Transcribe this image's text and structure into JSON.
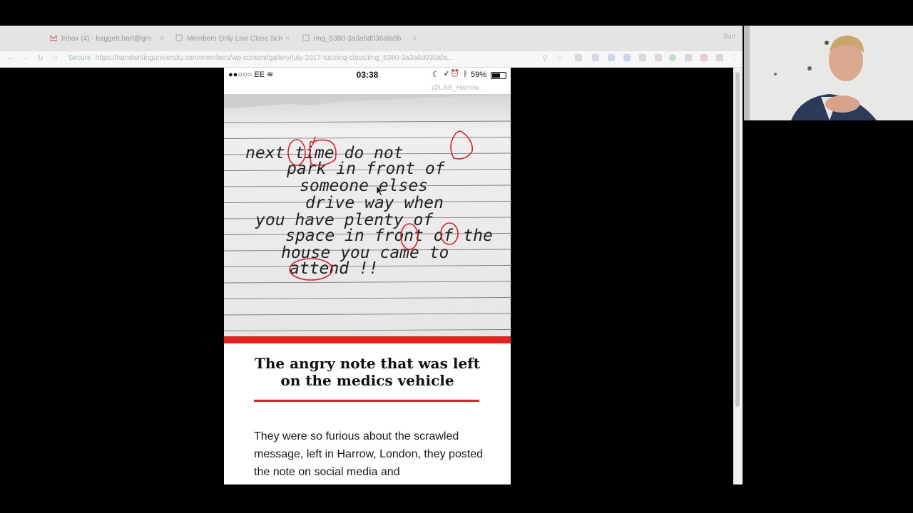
{
  "browser": {
    "tabs": [
      {
        "label": "Inbox (4) - baggett.bart@gm",
        "icon": "gmail-icon"
      },
      {
        "label": "Members Only Live Class Sch",
        "icon": "page-icon"
      },
      {
        "label": "img_5380-3a3a6d036afa6b",
        "icon": "page-icon"
      }
    ],
    "user": "Bart",
    "secure_label": "Secure",
    "url": "https://handwritinguniversity.com/members/wp-content/gallery/july-2017-tutoring-class/img_5380-3a3a6d036afa..."
  },
  "phone": {
    "carrier": "●●○○○ EE",
    "time": "03:38",
    "battery_label": "59%",
    "battery_level": 0.59,
    "handle": "@LAS_Harrow",
    "headline": "The angry note that was left on the medics vehicle",
    "body": "They were so furious about the scrawled message, left in Harrow, London, they posted the note on social media and"
  },
  "note": {
    "lines": [
      "next time do not",
      "park in front of",
      "someone elses",
      "drive way when",
      "you have plenty of",
      "space in front of the",
      "house you came to",
      "attend !!"
    ]
  },
  "colors": {
    "accent_red": "#e3231c",
    "annotation_red": "#e0202a"
  }
}
